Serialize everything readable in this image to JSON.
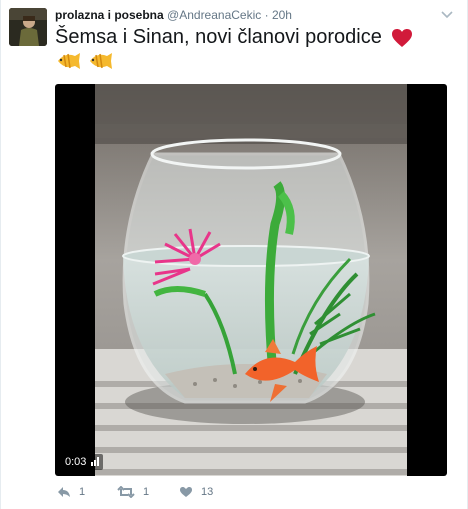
{
  "tweet": {
    "display_name": "prolazna i posebna",
    "handle": "@AndreanaCekic",
    "separator": "·",
    "time": "20h",
    "text": "Šemsa i Sinan, novi članovi porodice"
  },
  "media": {
    "duration": "0:03"
  },
  "actions": {
    "reply_count": "1",
    "retweet_count": "1",
    "like_count": "13"
  },
  "icons": {
    "heart_color": "#d11a3a",
    "fish_color": "#f5b92e"
  }
}
